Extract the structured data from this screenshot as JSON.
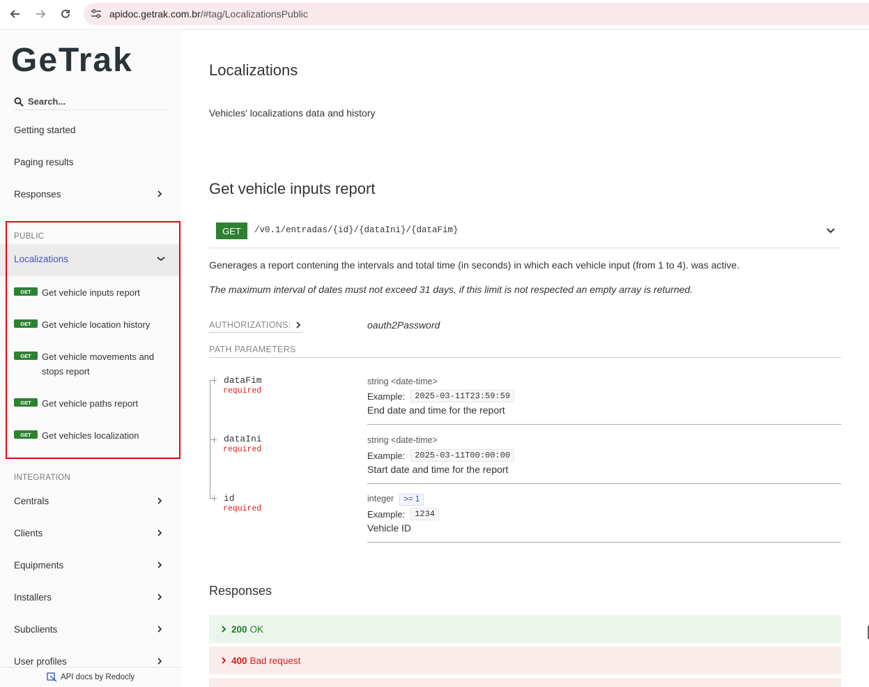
{
  "browser": {
    "url_host": "apidoc.getrak.com.br",
    "url_path": "/#tag/LocalizationsPublic"
  },
  "sidebar": {
    "logo_text": "GeTrak",
    "search_placeholder": "Search...",
    "top_items": [
      {
        "label": "Getting started"
      },
      {
        "label": "Paging results"
      },
      {
        "label": "Responses"
      }
    ],
    "public_section": {
      "label": "PUBLIC",
      "group_label": "Localizations",
      "operations": [
        {
          "method": "GET",
          "label": "Get vehicle inputs report"
        },
        {
          "method": "GET",
          "label": "Get vehicle location history"
        },
        {
          "method": "GET",
          "label": "Get vehicle movements and stops report"
        },
        {
          "method": "GET",
          "label": "Get vehicle paths report"
        },
        {
          "method": "GET",
          "label": "Get vehicles localization"
        }
      ]
    },
    "integration_section": {
      "label": "INTEGRATION",
      "items": [
        {
          "label": "Centrals"
        },
        {
          "label": "Clients"
        },
        {
          "label": "Equipments"
        },
        {
          "label": "Installers"
        },
        {
          "label": "Subclients"
        },
        {
          "label": "User profiles"
        }
      ]
    },
    "footer": "API docs by Redocly"
  },
  "main": {
    "tag_title": "Localizations",
    "tag_description": "Vehicles' localizations data and history",
    "operation_title": "Get vehicle inputs report",
    "method": "GET",
    "path": "/v0.1/entradas/{id}/{dataIni}/{dataFim}",
    "description_1": "Generages a report contening the intervals and total time (in seconds) in which each vehicle input (from 1 to 4). was active.",
    "description_2": "The maximum interval of dates must not exceed 31 days, if this limit is not respected an empty array is returned.",
    "authorizations_label": "AUTHORIZATIONS:",
    "authorizations_value": "oauth2Password",
    "path_params_label": "PATH PARAMETERS",
    "params": [
      {
        "name": "dataFim",
        "required": "required",
        "type": "string <date-time>",
        "range": "",
        "example_label": "Example:",
        "example": "2025-03-11T23:59:59",
        "description": "End date and time for the report"
      },
      {
        "name": "dataIni",
        "required": "required",
        "type": "string <date-time>",
        "range": "",
        "example_label": "Example:",
        "example": "2025-03-11T00:00:00",
        "description": "Start date and time for the report"
      },
      {
        "name": "id",
        "required": "required",
        "type": "integer",
        "range": ">= 1",
        "example_label": "Example:",
        "example": "1234",
        "description": "Vehicle ID"
      }
    ],
    "responses_title": "Responses",
    "responses": [
      {
        "code": "200",
        "label": "OK"
      },
      {
        "code": "400",
        "label": "Bad request"
      }
    ]
  },
  "colors": {
    "get_green": "#2f8132",
    "active_blue": "#4a4fc7",
    "highlight_red": "#e20613",
    "required_red": "#d41f1c"
  }
}
